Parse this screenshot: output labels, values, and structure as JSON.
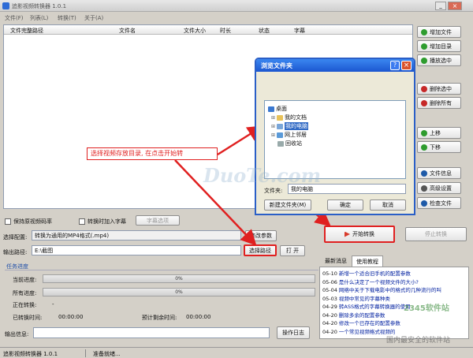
{
  "window": {
    "title": "追影视频转换器 1.0.1"
  },
  "menu": [
    "文件(F)",
    "列表(L)",
    "转换(T)",
    "关于(A)"
  ],
  "table": {
    "columns": [
      "文件完整路径",
      "文件名",
      "文件大小",
      "时长",
      "状态",
      "字幕"
    ]
  },
  "side_buttons": [
    {
      "label": "增加文件",
      "icon": "add-file-icon",
      "color": "#2e9c2e"
    },
    {
      "label": "增加目录",
      "icon": "add-folder-icon",
      "color": "#2e9c2e"
    },
    {
      "label": "播放选中",
      "icon": "play-icon",
      "color": "#2e9c2e"
    },
    {
      "label": "删除选中",
      "icon": "delete-icon",
      "color": "#c62828"
    },
    {
      "label": "删除所有",
      "icon": "delete-all-icon",
      "color": "#c62828"
    },
    {
      "label": "上移",
      "icon": "arrow-up-icon",
      "color": "#2e9c2e"
    },
    {
      "label": "下移",
      "icon": "arrow-down-icon",
      "color": "#2e9c2e"
    },
    {
      "label": "文件信息",
      "icon": "info-icon",
      "color": "#1e5aa8"
    },
    {
      "label": "高级设置",
      "icon": "settings-icon",
      "color": "#555555"
    },
    {
      "label": "检查文件",
      "icon": "check-file-icon",
      "color": "#1e5aa8"
    }
  ],
  "options": {
    "keep_bitrate": "保持原视频码率",
    "add_subtitle": "转换时加入字幕",
    "subtitle_options": "字幕选项"
  },
  "config": {
    "label": "选择配置:",
    "value": "转换为通用的MP4格式(.mp4)",
    "modify_button": "修改参数"
  },
  "output": {
    "label": "输出路径:",
    "value": "E:\\截图",
    "choose_button": "选择路径",
    "open_button": "打 开"
  },
  "actions": {
    "start": "开始转换",
    "stop": "停止转换"
  },
  "progress": {
    "section": "任务进度",
    "current_label": "当前进度:",
    "current_value": "0%",
    "current_fraction": 0,
    "all_label": "所有进度:",
    "all_value": "0%",
    "all_fraction": 0,
    "converting_label": "正在转换:",
    "converting_value": "-",
    "elapsed_label": "已转换时间:",
    "elapsed_value": "00:00:00",
    "remaining_label": "预计剩余时间:",
    "remaining_value": "00:00:00"
  },
  "output_info": {
    "label": "输出信息:",
    "log_button": "操作日志"
  },
  "news": {
    "tabs": [
      "最新消息",
      "使用教程"
    ],
    "items": [
      {
        "date": "05-10",
        "text": "新增一个适合旧手机的配置参数"
      },
      {
        "date": "05-06",
        "text": "是什么决定了一个视频文件的大小?"
      },
      {
        "date": "05-04",
        "text": "网络中关于下载电影中的格式的几种流行的叫"
      },
      {
        "date": "05-03",
        "text": "视频中常见的字幕种类"
      },
      {
        "date": "04-29",
        "text": "转ASS格式的字幕转换器的使用"
      },
      {
        "date": "04-20",
        "text": "删除多余的配置参数"
      },
      {
        "date": "04-20",
        "text": "修改一个已存在的配置参数"
      },
      {
        "date": "04-20",
        "text": "一个常见视频格式视频的"
      }
    ]
  },
  "status": {
    "app": "追影视频转换器 1.0.1",
    "state": "准备就绪..."
  },
  "annotation": "选择视频存放目录, 在点击开始转",
  "dialog": {
    "title": "浏览文件夹",
    "tree": [
      "桌面",
      "我的文档",
      "我的电脑",
      "网上邻居",
      "回收站"
    ],
    "folder_label": "文件夹:",
    "folder_value": "我的电脑",
    "new_folder": "新建文件夹(M)",
    "ok": "确定",
    "cancel": "取消",
    "help": "?",
    "close": "×"
  },
  "watermark": {
    "text": "DuoTe.com",
    "corner": "2345软件站",
    "corner2": "国内最安全的软件站"
  },
  "colors": {
    "accent": "#2d6bd6",
    "arrow": "#e02020",
    "annotation": "#e02020"
  }
}
